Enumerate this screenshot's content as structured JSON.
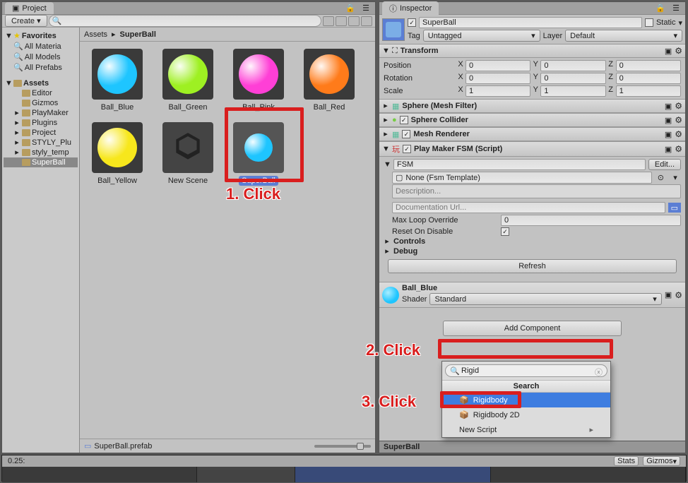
{
  "project": {
    "tab": "Project",
    "create": "Create",
    "favorites": "Favorites",
    "fav_items": [
      "All Materia",
      "All Models",
      "All Prefabs"
    ],
    "assets_root": "Assets",
    "tree": [
      "Editor",
      "Gizmos",
      "PlayMaker",
      "Plugins",
      "Project",
      "STYLY_Plu",
      "styly_temp",
      "SuperBall"
    ],
    "breadcrumb": {
      "root": "Assets",
      "current": "SuperBall"
    },
    "grid": [
      {
        "name": "Ball_Blue",
        "color": "#1ec5ff"
      },
      {
        "name": "Ball_Green",
        "color": "#9ef022"
      },
      {
        "name": "Ball_Pink",
        "color": "#ff3fd6"
      },
      {
        "name": "Ball_Red",
        "color": "#ff7b1a"
      },
      {
        "name": "Ball_Yellow",
        "color": "#f7e71c"
      },
      {
        "name": "New Scene",
        "scene": true
      },
      {
        "name": "SuperBall",
        "prefab": true,
        "sel": true,
        "color": "#1ec5ff"
      }
    ],
    "footer": "SuperBall.prefab"
  },
  "inspector": {
    "tab": "Inspector",
    "name": "SuperBall",
    "static": "Static",
    "tag_lbl": "Tag",
    "tag_val": "Untagged",
    "layer_lbl": "Layer",
    "layer_val": "Default",
    "transform": {
      "title": "Transform",
      "pos": "Position",
      "rot": "Rotation",
      "scale": "Scale",
      "pv": {
        "x": "0",
        "y": "0",
        "z": "0"
      },
      "rv": {
        "x": "0",
        "y": "0",
        "z": "0"
      },
      "sv": {
        "x": "1",
        "y": "1",
        "z": "1"
      }
    },
    "components": {
      "mesh_filter": "Sphere (Mesh Filter)",
      "collider": "Sphere Collider",
      "renderer": "Mesh Renderer",
      "fsm": "Play Maker FSM (Script)"
    },
    "fsm": {
      "label": "FSM",
      "edit": "Edit...",
      "template": "None (Fsm Template)",
      "desc": "Description...",
      "doc": "Documentation Url...",
      "maxloop_lbl": "Max Loop Override",
      "maxloop": "0",
      "reset_lbl": "Reset On Disable",
      "controls": "Controls",
      "debug": "Debug",
      "refresh": "Refresh"
    },
    "material": {
      "name": "Ball_Blue",
      "shader_lbl": "Shader",
      "shader": "Standard"
    },
    "add_component": "Add Component",
    "asset_bar": "SuperBall"
  },
  "popup": {
    "search": "Rigid",
    "header": "Search",
    "items": [
      "Rigidbody",
      "Rigidbody 2D",
      "New Script"
    ]
  },
  "anno": {
    "c1": "1. Click",
    "c2": "2. Click",
    "c3": "3. Click"
  },
  "timeline": {
    "time": "0.25:",
    "stats": "Stats",
    "gizmos": "Gizmos"
  }
}
